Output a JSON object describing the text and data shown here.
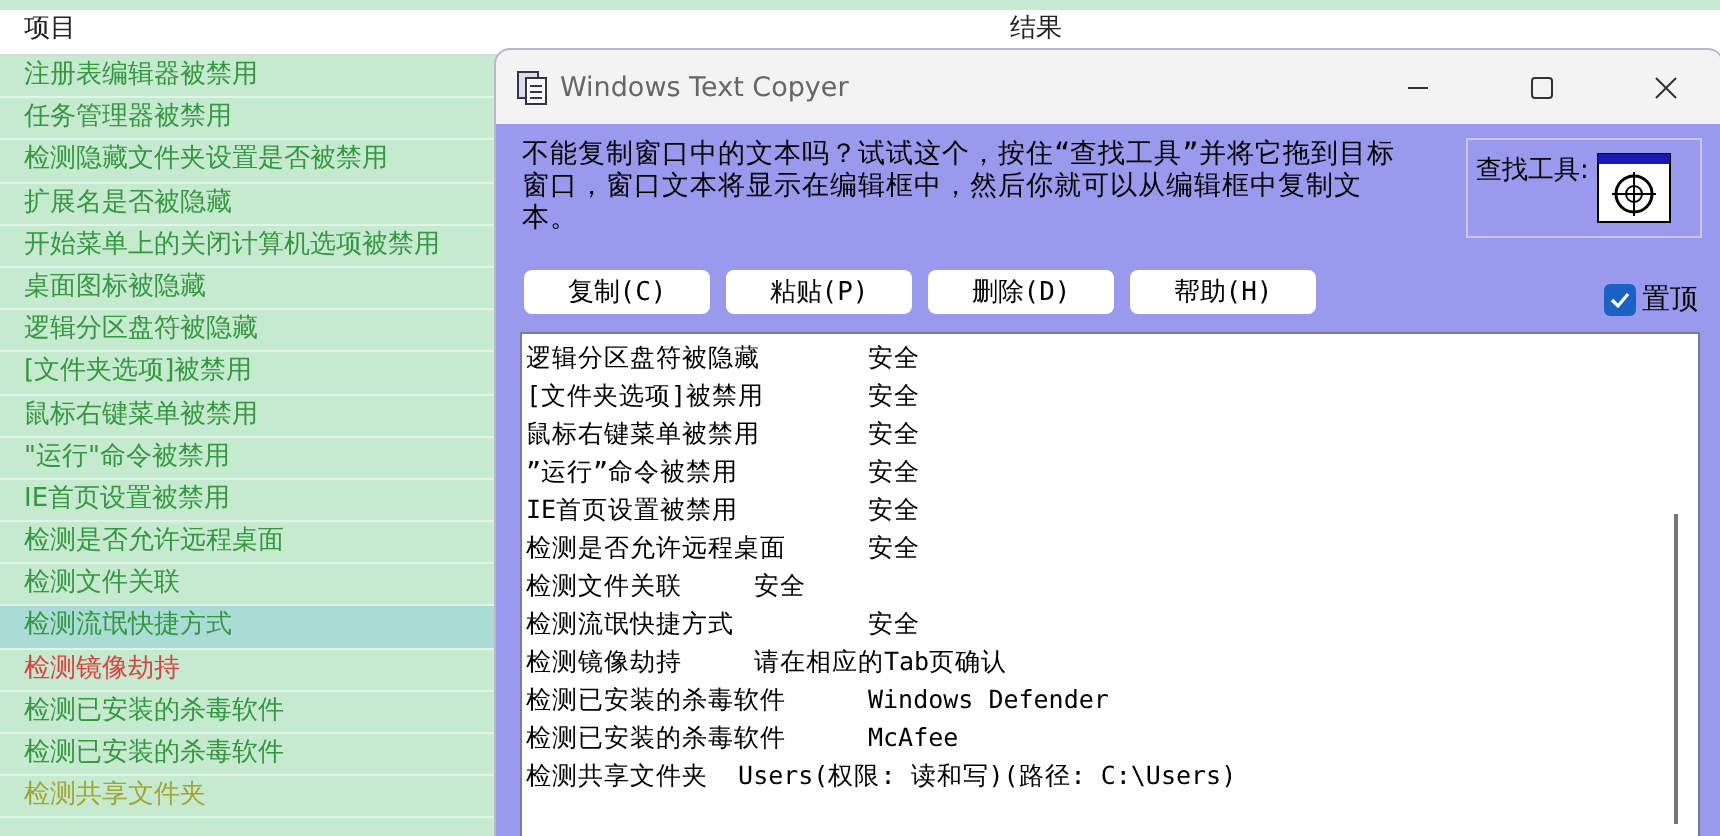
{
  "list": {
    "columns": [
      "项目",
      "结果"
    ],
    "rows": [
      {
        "label": "注册表编辑器被禁用",
        "color": "#35973f",
        "selected": false
      },
      {
        "label": "任务管理器被禁用",
        "color": "#35973f",
        "selected": false
      },
      {
        "label": "检测隐藏文件夹设置是否被禁用",
        "color": "#35973f",
        "selected": false
      },
      {
        "label": "扩展名是否被隐藏",
        "color": "#35973f",
        "selected": false
      },
      {
        "label": "开始菜单上的关闭计算机选项被禁用",
        "color": "#35973f",
        "selected": false
      },
      {
        "label": "桌面图标被隐藏",
        "color": "#35973f",
        "selected": false
      },
      {
        "label": "逻辑分区盘符被隐藏",
        "color": "#35973f",
        "selected": false
      },
      {
        "label": "[文件夹选项]被禁用",
        "color": "#35973f",
        "selected": false
      },
      {
        "label": "鼠标右键菜单被禁用",
        "color": "#35973f",
        "selected": false
      },
      {
        "label": "\"运行\"命令被禁用",
        "color": "#35973f",
        "selected": false
      },
      {
        "label": "IE首页设置被禁用",
        "color": "#35973f",
        "selected": false
      },
      {
        "label": "检测是否允许远程桌面",
        "color": "#35973f",
        "selected": false
      },
      {
        "label": "检测文件关联",
        "color": "#35973f",
        "selected": false
      },
      {
        "label": "检测流氓快捷方式",
        "color": "#35973f",
        "selected": true
      },
      {
        "label": "检测镜像劫持",
        "color": "#e0403c",
        "selected": false
      },
      {
        "label": "检测已安装的杀毒软件",
        "color": "#35973f",
        "selected": false
      },
      {
        "label": "检测已安装的杀毒软件",
        "color": "#35973f",
        "selected": false
      },
      {
        "label": "检测共享文件夹",
        "color": "#a3a532",
        "selected": false
      }
    ]
  },
  "window": {
    "title": "Windows Text Copyer",
    "description": "不能复制窗口中的文本吗？试试这个，按住“查找工具”并将它拖到目标窗口，窗口文本将显示在编辑框中，然后你就可以从编辑框中复制文本。",
    "finder_label": "查找工具:",
    "buttons": [
      "复制(C)",
      "粘贴(P)",
      "删除(D)",
      "帮助(H)"
    ],
    "topmost": {
      "label": "置顶",
      "checked": true
    },
    "lines": [
      "逻辑分区盘符被隐藏\t安全",
      "[文件夹选项]被禁用\t安全",
      "鼠标右键菜单被禁用\t安全",
      "”运行”命令被禁用\t\t安全",
      "IE首页设置被禁用\t\t安全",
      "检测是否允许远程桌面\t安全",
      "检测文件关联\t安全",
      "检测流氓快捷方式\t\t安全",
      "检测镜像劫持\t请在相应的Tab页确认",
      "检测已安装的杀毒软件\tWindows Defender",
      "检测已安装的杀毒软件\tMcAfee",
      "检测共享文件夹  Users(权限: 读和写)(路径: C:\\Users)"
    ]
  }
}
